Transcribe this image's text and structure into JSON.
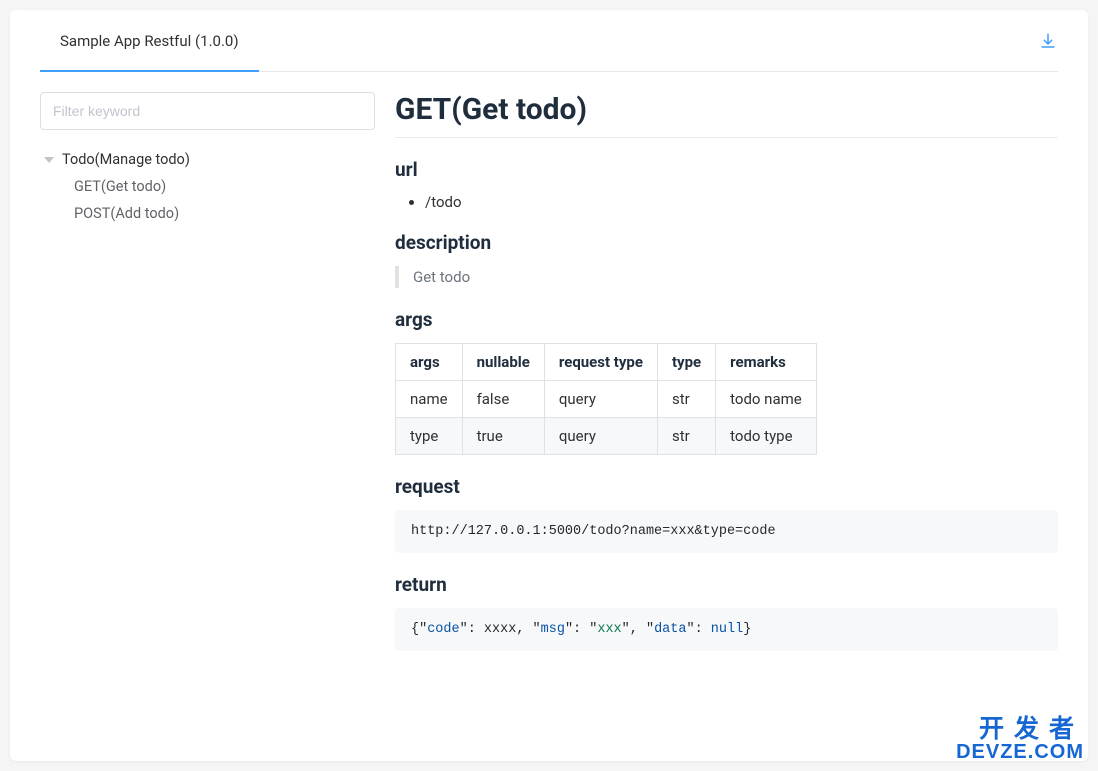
{
  "tab": {
    "title": "Sample App Restful (1.0.0)"
  },
  "filter": {
    "placeholder": "Filter keyword"
  },
  "tree": {
    "root": "Todo(Manage todo)",
    "children": [
      "GET(Get todo)",
      "POST(Add todo)"
    ]
  },
  "main": {
    "title": "GET(Get todo)",
    "sections": {
      "url": {
        "heading": "url",
        "items": [
          "/todo"
        ]
      },
      "description": {
        "heading": "description",
        "text": "Get todo"
      },
      "args": {
        "heading": "args",
        "headers": [
          "args",
          "nullable",
          "request type",
          "type",
          "remarks"
        ],
        "rows": [
          [
            "name",
            "false",
            "query",
            "str",
            "todo name"
          ],
          [
            "type",
            "true",
            "query",
            "str",
            "todo type"
          ]
        ]
      },
      "request": {
        "heading": "request",
        "code": "http://127.0.0.1:5000/todo?name=xxx&type=code"
      },
      "return": {
        "heading": "return",
        "json": {
          "open": "{\"",
          "k1": "code",
          "sep1": "\": xxxx, \"",
          "k2": "msg",
          "sep2": "\": \"",
          "v2": "xxx",
          "sep3": "\", \"",
          "k3": "data",
          "sep4": "\": ",
          "v3": "null",
          "close": "}"
        }
      }
    }
  },
  "watermark": {
    "line1": "开发者",
    "line2": "DEVZE.COM"
  }
}
